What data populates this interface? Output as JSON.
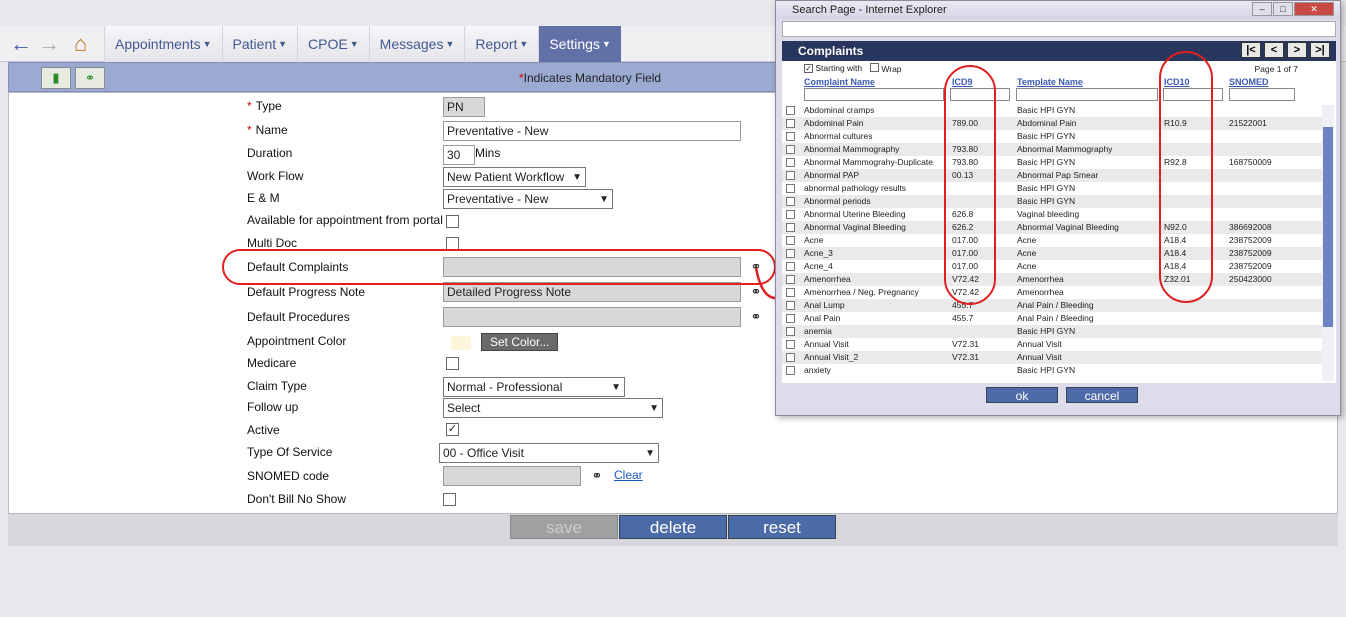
{
  "nav": {
    "back": "←",
    "forward": "→",
    "home": "⌂",
    "menu": [
      {
        "label": "Appointments"
      },
      {
        "label": "Patient"
      },
      {
        "label": "CPOE"
      },
      {
        "label": "Messages"
      },
      {
        "label": "Report"
      },
      {
        "label": "Settings"
      }
    ]
  },
  "toolbar": {
    "mandatory_star": "*",
    "mandatory_text": "Indicates Mandatory Field"
  },
  "form": {
    "type_label": "Type",
    "type_value": "PN",
    "name_label": "Name",
    "name_value": "Preventative - New",
    "duration_label": "Duration",
    "duration_value": "30",
    "duration_unit": "Mins",
    "workflow_label": "Work Flow",
    "workflow_value": "New Patient Workflow",
    "em_label": "E & M",
    "em_value": "Preventative - New",
    "portal_label": "Available for appointment from portal",
    "multidoc_label": "Multi Doc",
    "complaints_label": "Default Complaints",
    "progress_label": "Default Progress Note",
    "progress_value": "Detailed Progress Note",
    "procedures_label": "Default Procedures",
    "color_label": "Appointment Color",
    "set_color": "Set Color...",
    "medicare_label": "Medicare",
    "claim_label": "Claim Type",
    "claim_value": "Normal - Professional",
    "followup_label": "Follow up",
    "followup_value": "Select",
    "active_label": "Active",
    "active_check": "✓",
    "tos_label": "Type Of Service",
    "tos_value": "00 - Office Visit",
    "snomed_label": "SNOMED code",
    "clear": "Clear",
    "noshow_label": "Don't Bill No Show"
  },
  "buttons": {
    "save": "save",
    "delete": "delete",
    "reset": "reset"
  },
  "popup": {
    "window_title": "Search Page - Internet Explorer",
    "header": "Complaints",
    "pager": [
      "|<",
      "<",
      ">",
      ">|"
    ],
    "starting_with": "Starting with",
    "wrap": "Wrap",
    "page_info": "Page 1 of 7",
    "columns": [
      "Complaint Name",
      "ICD9",
      "Template Name",
      "ICD10",
      "SNOMED"
    ],
    "rows": [
      [
        "Abdominal cramps",
        "",
        "Basic HPI GYN",
        "",
        ""
      ],
      [
        "Abdominal Pain",
        "789.00",
        "Abdominal Pain",
        "R10.9",
        "21522001"
      ],
      [
        "Abnormal cultures",
        "",
        "Basic HPI GYN",
        "",
        ""
      ],
      [
        "Abnormal Mammography",
        "793.80",
        "Abnormal Mammography",
        "",
        ""
      ],
      [
        "Abnormal Mammograhy-Duplicate",
        "793.80",
        "Basic HPI GYN",
        "R92.8",
        "168750009"
      ],
      [
        "Abnormal PAP",
        "00.13",
        "Abnormal Pap Smear",
        "",
        ""
      ],
      [
        "abnormal pathology results",
        "",
        "Basic HPI GYN",
        "",
        ""
      ],
      [
        "Abnormal periods",
        "",
        "Basic HPI GYN",
        "",
        ""
      ],
      [
        "Abnormal Uterine Bleeding",
        "626.8",
        "Vaginal bleeding",
        "",
        ""
      ],
      [
        "Abnormal Vaginal Bleeding",
        "626.2",
        "Abnormal Vaginal Bleeding",
        "N92.0",
        "386692008"
      ],
      [
        "Acne",
        "017.00",
        "Acne",
        "A18.4",
        "238752009"
      ],
      [
        "Acne_3",
        "017.00",
        "Acne",
        "A18.4",
        "238752009"
      ],
      [
        "Acne_4",
        "017.00",
        "Acne",
        "A18.4",
        "238752009"
      ],
      [
        "Amenorrhea",
        "V72.42",
        "Amenorrhea",
        "Z32.01",
        "250423000"
      ],
      [
        "Amenorrhea / Neg. Pregnancy",
        "V72.42",
        "Amenorrhea",
        "",
        ""
      ],
      [
        "Anal Lump",
        "455.7",
        "Anal Pain / Bleeding",
        "",
        ""
      ],
      [
        "Anal Pain",
        "455.7",
        "Anal Pain / Bleeding",
        "",
        ""
      ],
      [
        "anemia",
        "",
        "Basic HPI GYN",
        "",
        ""
      ],
      [
        "Annual Visit",
        "V72.31",
        "Annual Visit",
        "",
        ""
      ],
      [
        "Annual Visit_2",
        "V72.31",
        "Annual Visit",
        "",
        ""
      ],
      [
        "anxiety",
        "",
        "Basic HPI GYN",
        "",
        ""
      ]
    ],
    "ok": "ok",
    "cancel": "cancel"
  },
  "colors": {
    "menu_active": "#6270a8",
    "toolstrip": "#9aaad0",
    "popup_header": "#28365e",
    "button": "#4a6aa8",
    "annotation": "#e02020"
  }
}
